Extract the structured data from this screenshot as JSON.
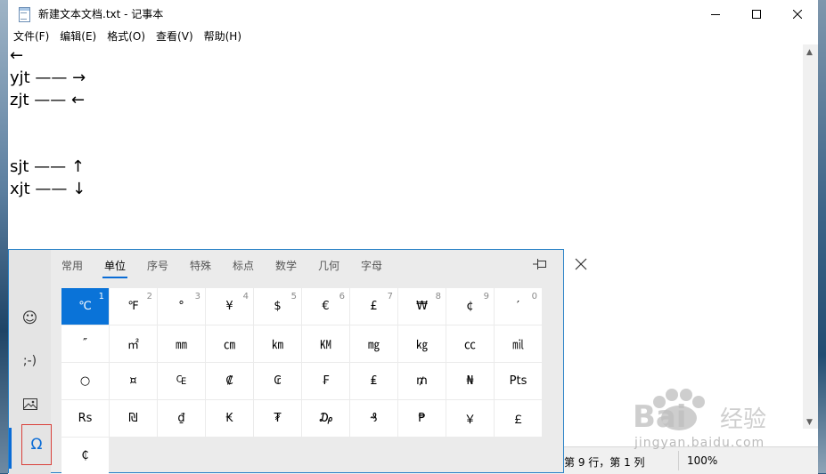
{
  "window": {
    "title": "新建文本文档.txt - 记事本",
    "controls": [
      "minimize",
      "maximize",
      "close"
    ]
  },
  "menu": [
    "文件(F)",
    "编辑(E)",
    "格式(O)",
    "查看(V)",
    "帮助(H)"
  ],
  "editor": {
    "lines": [
      "←",
      "yjt —— →",
      "zjt —— ←",
      "",
      "",
      "sjt —— ↑",
      "xjt —— ↓"
    ]
  },
  "status": {
    "position": "第 9 行，第 1 列",
    "zoom": "100%"
  },
  "panel": {
    "side_buttons": [
      {
        "name": "emoji",
        "glyph": "☺"
      },
      {
        "name": "kaomoji",
        "glyph": ";-)"
      },
      {
        "name": "gif",
        "glyph": "🖼"
      },
      {
        "name": "symbols",
        "glyph": "Ω"
      }
    ],
    "tabs": [
      "常用",
      "单位",
      "序号",
      "特殊",
      "标点",
      "数学",
      "几何",
      "字母"
    ],
    "active_tab": "单位",
    "symbols": [
      [
        {
          "s": "℃",
          "n": "1"
        },
        {
          "s": "℉",
          "n": "2"
        },
        {
          "s": "°",
          "n": "3"
        },
        {
          "s": "¥",
          "n": "4"
        },
        {
          "s": "$",
          "n": "5"
        },
        {
          "s": "€",
          "n": "6"
        },
        {
          "s": "£",
          "n": "7"
        },
        {
          "s": "₩",
          "n": "8"
        },
        {
          "s": "¢",
          "n": "9"
        },
        {
          "s": "′",
          "n": "0"
        }
      ],
      [
        {
          "s": "″"
        },
        {
          "s": "㎡"
        },
        {
          "s": "㎜"
        },
        {
          "s": "㎝"
        },
        {
          "s": "㎞"
        },
        {
          "s": "㏎"
        },
        {
          "s": "㎎"
        },
        {
          "s": "㎏"
        },
        {
          "s": "㏄"
        },
        {
          "s": "㏕"
        }
      ],
      [
        {
          "s": "○"
        },
        {
          "s": "¤"
        },
        {
          "s": "₠"
        },
        {
          "s": "₡"
        },
        {
          "s": "₢"
        },
        {
          "s": "₣"
        },
        {
          "s": "₤"
        },
        {
          "s": "₥"
        },
        {
          "s": "₦"
        },
        {
          "s": "Pts"
        }
      ],
      [
        {
          "s": "Rs"
        },
        {
          "s": "₪"
        },
        {
          "s": "₫"
        },
        {
          "s": "₭"
        },
        {
          "s": "₮"
        },
        {
          "s": "₯"
        },
        {
          "s": "₰"
        },
        {
          "s": "₱"
        },
        {
          "s": "￥"
        },
        {
          "s": "￡"
        }
      ],
      [
        {
          "s": "₵"
        }
      ]
    ]
  },
  "watermark": {
    "logo": "Bai du 经验",
    "url": "jingyan.baidu.com"
  },
  "colors": {
    "accent": "#0a73d8",
    "highlight_border": "#d9403a"
  }
}
